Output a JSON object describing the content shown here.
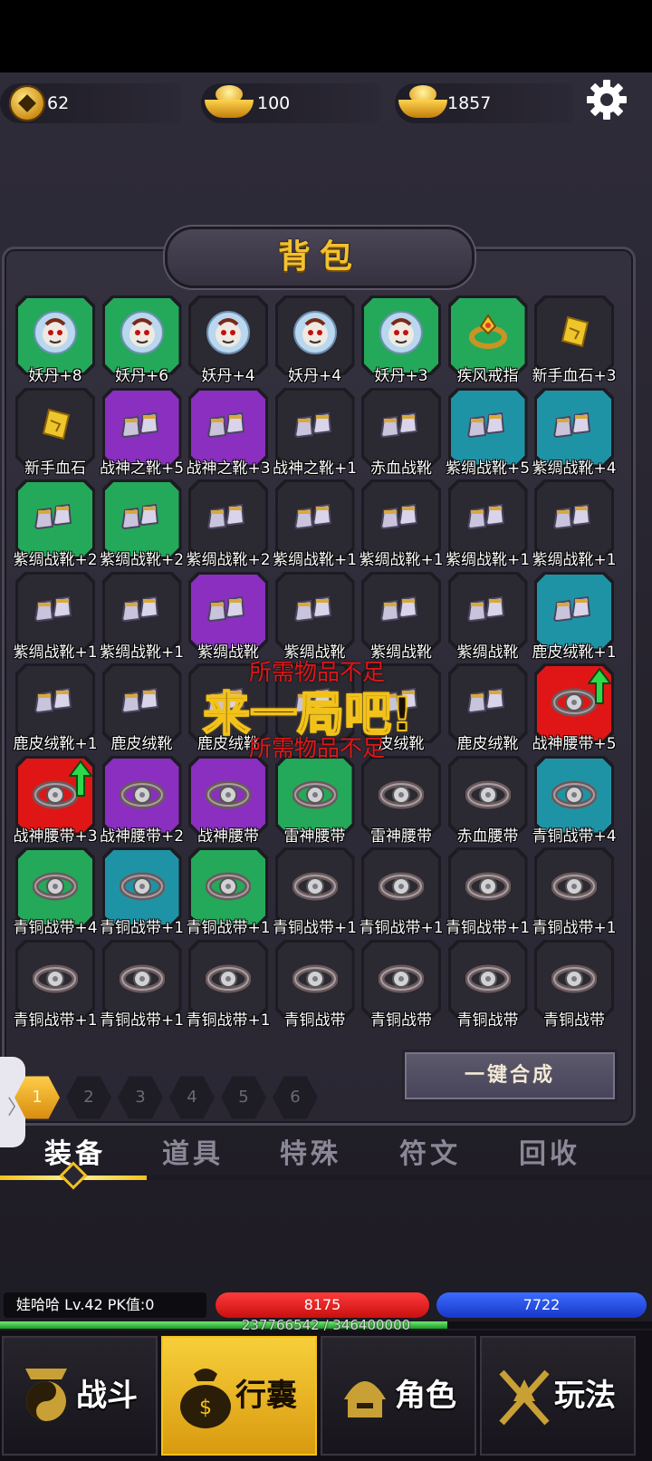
{
  "currency": [
    {
      "name": "copper-coin",
      "value": "62"
    },
    {
      "name": "gold-ingot",
      "value": "100"
    },
    {
      "name": "gold-pile",
      "value": "1857"
    }
  ],
  "panel_title": "背包",
  "colors": {
    "green": "#24a95a",
    "purple": "#8a2fc0",
    "teal": "#1f93a6",
    "red": "#e01616",
    "dark": "#2b2931",
    "gold": "#f3c21a"
  },
  "items": [
    {
      "label": "妖丹+8",
      "rarity": "green",
      "icon": "demon-core-icon"
    },
    {
      "label": "妖丹+6",
      "rarity": "green",
      "icon": "demon-core-icon"
    },
    {
      "label": "妖丹+4",
      "rarity": "dark",
      "icon": "demon-core-icon"
    },
    {
      "label": "妖丹+4",
      "rarity": "dark",
      "icon": "demon-core-icon"
    },
    {
      "label": "妖丹+3",
      "rarity": "green",
      "icon": "demon-core-icon"
    },
    {
      "label": "疾风戒指",
      "rarity": "green",
      "icon": "ring-icon"
    },
    {
      "label": "新手血石+3",
      "rarity": "dark",
      "icon": "blood-stone-icon"
    },
    {
      "label": "新手血石",
      "rarity": "dark",
      "icon": "blood-stone-icon"
    },
    {
      "label": "战神之靴+5",
      "rarity": "purple",
      "icon": "boots-icon"
    },
    {
      "label": "战神之靴+3",
      "rarity": "purple",
      "icon": "boots-icon"
    },
    {
      "label": "战神之靴+1",
      "rarity": "dark",
      "icon": "boots-icon"
    },
    {
      "label": "赤血战靴",
      "rarity": "dark",
      "icon": "boots-icon"
    },
    {
      "label": "紫绸战靴+5",
      "rarity": "teal",
      "icon": "boots-icon"
    },
    {
      "label": "紫绸战靴+4",
      "rarity": "teal",
      "icon": "boots-icon"
    },
    {
      "label": "紫绸战靴+2",
      "rarity": "green",
      "icon": "boots-icon"
    },
    {
      "label": "紫绸战靴+2",
      "rarity": "green",
      "icon": "boots-icon"
    },
    {
      "label": "紫绸战靴+2",
      "rarity": "dark",
      "icon": "boots-icon"
    },
    {
      "label": "紫绸战靴+1",
      "rarity": "dark",
      "icon": "boots-icon"
    },
    {
      "label": "紫绸战靴+1",
      "rarity": "dark",
      "icon": "boots-icon"
    },
    {
      "label": "紫绸战靴+1",
      "rarity": "dark",
      "icon": "boots-icon"
    },
    {
      "label": "紫绸战靴+1",
      "rarity": "dark",
      "icon": "boots-icon"
    },
    {
      "label": "紫绸战靴+1",
      "rarity": "dark",
      "icon": "boots-icon"
    },
    {
      "label": "紫绸战靴+1",
      "rarity": "dark",
      "icon": "boots-icon"
    },
    {
      "label": "紫绸战靴",
      "rarity": "purple",
      "icon": "boots-icon"
    },
    {
      "label": "紫绸战靴",
      "rarity": "dark",
      "icon": "boots-icon"
    },
    {
      "label": "紫绸战靴",
      "rarity": "dark",
      "icon": "boots-icon"
    },
    {
      "label": "紫绸战靴",
      "rarity": "dark",
      "icon": "boots-icon"
    },
    {
      "label": "鹿皮绒靴+1",
      "rarity": "teal",
      "icon": "boots-icon"
    },
    {
      "label": "鹿皮绒靴+1",
      "rarity": "dark",
      "icon": "boots-icon"
    },
    {
      "label": "鹿皮绒靴",
      "rarity": "dark",
      "icon": "boots-icon"
    },
    {
      "label": "鹿皮绒靴",
      "rarity": "dark",
      "icon": "boots-icon"
    },
    {
      "label": "",
      "rarity": "dark",
      "icon": "boots-icon"
    },
    {
      "label": "皮绒靴",
      "rarity": "dark",
      "icon": "boots-icon"
    },
    {
      "label": "鹿皮绒靴",
      "rarity": "dark",
      "icon": "boots-icon"
    },
    {
      "label": "战神腰带+5",
      "rarity": "red",
      "icon": "belt-icon",
      "upgrade": true
    },
    {
      "label": "战神腰带+3",
      "rarity": "red",
      "icon": "belt-icon",
      "upgrade": true
    },
    {
      "label": "战神腰带+2",
      "rarity": "purple",
      "icon": "belt-icon"
    },
    {
      "label": "战神腰带",
      "rarity": "purple",
      "icon": "belt-icon"
    },
    {
      "label": "雷神腰带",
      "rarity": "green",
      "icon": "belt-icon"
    },
    {
      "label": "雷神腰带",
      "rarity": "dark",
      "icon": "belt-icon"
    },
    {
      "label": "赤血腰带",
      "rarity": "dark",
      "icon": "belt-icon"
    },
    {
      "label": "青铜战带+4",
      "rarity": "teal",
      "icon": "belt-icon"
    },
    {
      "label": "青铜战带+4",
      "rarity": "green",
      "icon": "belt-icon"
    },
    {
      "label": "青铜战带+1",
      "rarity": "teal",
      "icon": "belt-icon"
    },
    {
      "label": "青铜战带+1",
      "rarity": "green",
      "icon": "belt-icon"
    },
    {
      "label": "青铜战带+1",
      "rarity": "dark",
      "icon": "belt-icon"
    },
    {
      "label": "青铜战带+1",
      "rarity": "dark",
      "icon": "belt-icon"
    },
    {
      "label": "青铜战带+1",
      "rarity": "dark",
      "icon": "belt-icon"
    },
    {
      "label": "青铜战带+1",
      "rarity": "dark",
      "icon": "belt-icon"
    },
    {
      "label": "青铜战带+1",
      "rarity": "dark",
      "icon": "belt-icon"
    },
    {
      "label": "青铜战带+1",
      "rarity": "dark",
      "icon": "belt-icon"
    },
    {
      "label": "青铜战带+1",
      "rarity": "dark",
      "icon": "belt-icon"
    },
    {
      "label": "青铜战带",
      "rarity": "dark",
      "icon": "belt-icon"
    },
    {
      "label": "青铜战带",
      "rarity": "dark",
      "icon": "belt-icon"
    },
    {
      "label": "青铜战带",
      "rarity": "dark",
      "icon": "belt-icon"
    },
    {
      "label": "青铜战带",
      "rarity": "dark",
      "icon": "belt-icon"
    }
  ],
  "overlay": {
    "not_enough_1": "所需物品不足",
    "play_prompt": "来一局吧!",
    "not_enough_2": "所需物品不足"
  },
  "pages": [
    "1",
    "2",
    "3",
    "4",
    "5",
    "6"
  ],
  "active_page": "1",
  "synthesize_label": "一键合成",
  "side_handle": "〉",
  "tabs": [
    "装备",
    "道具",
    "特殊",
    "符文",
    "回收"
  ],
  "active_tab": "装备",
  "player": {
    "name_level": "娃哈哈  Lv.42 PK值:0",
    "hp": "8175",
    "mp": "7722",
    "exp_text": "237766542 / 346400000",
    "exp_fraction": 0.686
  },
  "nav": [
    {
      "label": "战斗",
      "icon": "yin-yang-warrior-icon"
    },
    {
      "label": "行囊",
      "icon": "money-bag-icon"
    },
    {
      "label": "角色",
      "icon": "helmet-character-icon"
    },
    {
      "label": "玩法",
      "icon": "swords-gameplay-icon"
    }
  ],
  "active_nav": "行囊"
}
